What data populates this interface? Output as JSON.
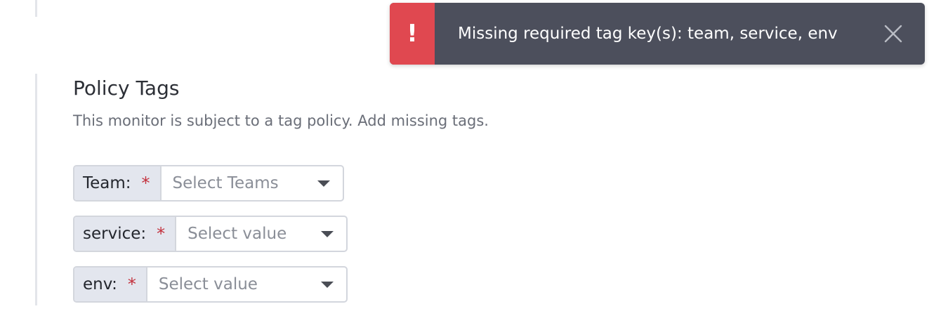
{
  "toast": {
    "icon": "exclamation-icon",
    "icon_glyph": "!",
    "message": "Missing required tag key(s): team, service, env",
    "close_icon": "close-icon",
    "accent_color": "#e04850",
    "background_color": "#4c4f5c"
  },
  "policy_tags": {
    "title": "Policy Tags",
    "description": "This monitor is subject to a tag policy. Add missing tags.",
    "tags": [
      {
        "key": "Team:",
        "required_mark": "*",
        "placeholder": "Select Teams"
      },
      {
        "key": "service:",
        "required_mark": "*",
        "placeholder": "Select value"
      },
      {
        "key": "env:",
        "required_mark": "*",
        "placeholder": "Select value"
      }
    ]
  }
}
